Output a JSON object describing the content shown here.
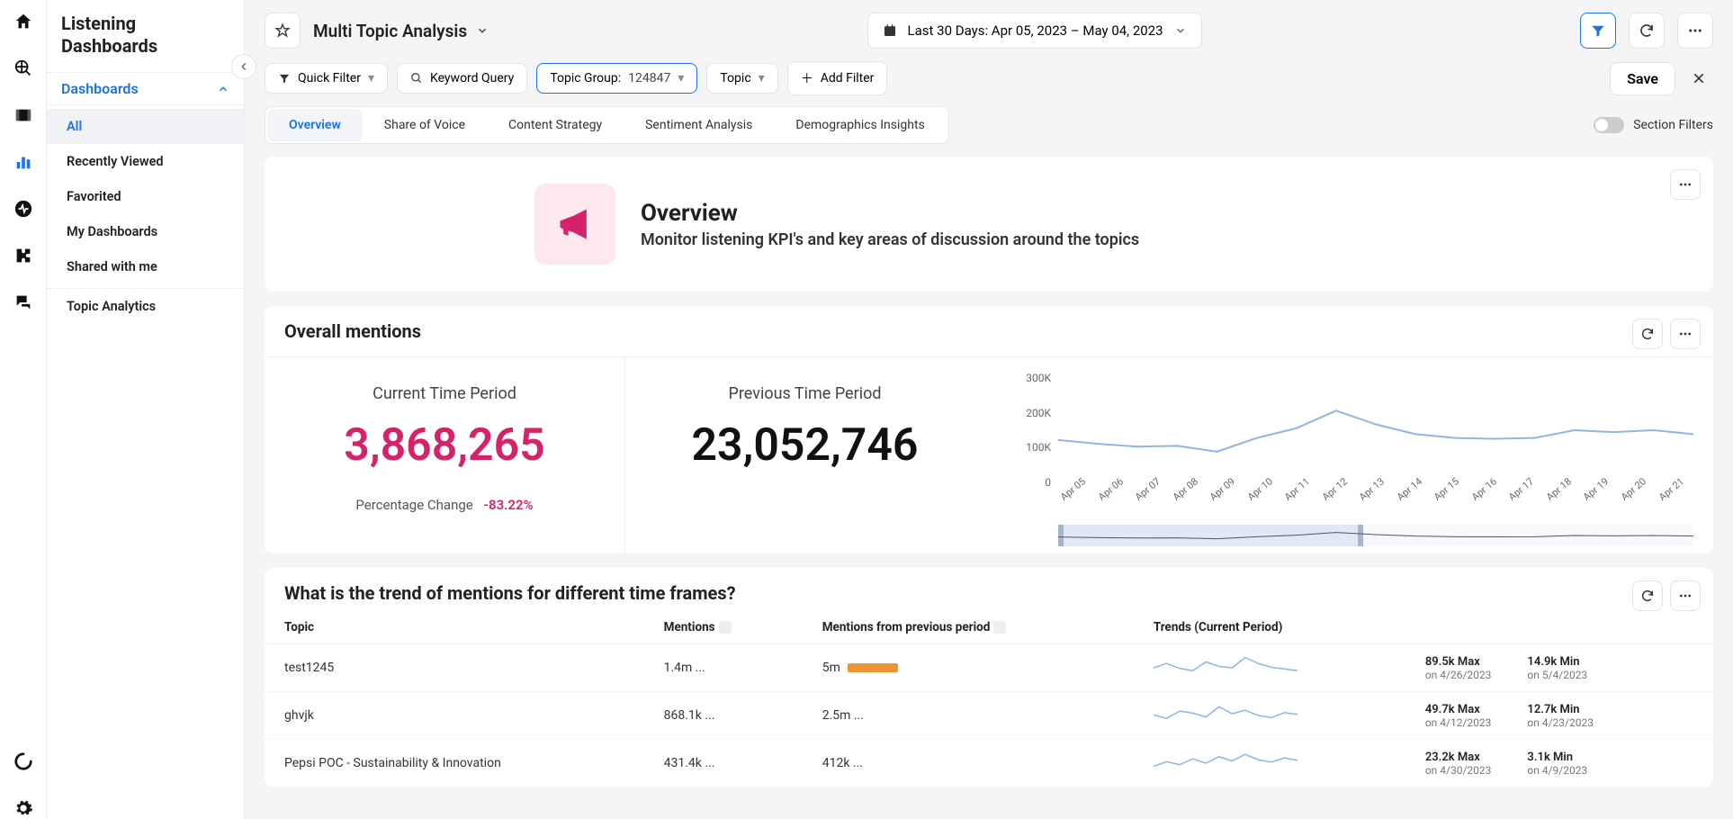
{
  "app_title": "Listening Dashboards",
  "sidebar": {
    "section_label": "Dashboards",
    "items": [
      "All",
      "Recently Viewed",
      "Favorited",
      "My Dashboards",
      "Shared with me"
    ],
    "secondary": "Topic Analytics"
  },
  "topbar": {
    "title": "Multi Topic Analysis",
    "date_label": "Last 30 Days: Apr 05, 2023 – May 04, 2023"
  },
  "filters": {
    "quick_filter": "Quick Filter",
    "keyword_query": "Keyword Query",
    "topic_group_label": "Topic Group:",
    "topic_group_value": "124847",
    "topic": "Topic",
    "add_filter": "Add Filter",
    "save": "Save"
  },
  "tabs": [
    "Overview",
    "Share of Voice",
    "Content Strategy",
    "Sentiment Analysis",
    "Demographics Insights"
  ],
  "section_filters_label": "Section Filters",
  "overview": {
    "title": "Overview",
    "subtitle": "Monitor listening KPI's and key areas of discussion around the topics"
  },
  "mentions": {
    "title": "Overall mentions",
    "current_label": "Current Time Period",
    "current_value": "3,868,265",
    "previous_label": "Previous Time Period",
    "previous_value": "23,052,746",
    "pct_label": "Percentage Change",
    "pct_value": "-83.22%"
  },
  "chart_data": {
    "type": "line",
    "title": "Overall mentions",
    "xlabel": "",
    "ylabel": "",
    "ylim": [
      0,
      300000
    ],
    "y_ticks": [
      "300K",
      "200K",
      "100K",
      "0"
    ],
    "x": [
      "Apr 05",
      "Apr 06",
      "Apr 07",
      "Apr 08",
      "Apr 09",
      "Apr 10",
      "Apr 11",
      "Apr 12",
      "Apr 13",
      "Apr 14",
      "Apr 15",
      "Apr 16",
      "Apr 17",
      "Apr 18",
      "Apr 19",
      "Apr 20",
      "Apr 21"
    ],
    "values": [
      125000,
      115000,
      108000,
      110000,
      95000,
      130000,
      155000,
      200000,
      165000,
      140000,
      130000,
      128000,
      130000,
      150000,
      145000,
      150000,
      140000
    ]
  },
  "trend": {
    "title": "What is the trend of mentions for different time frames?",
    "columns": [
      "Topic",
      "Mentions",
      "Mentions from previous period",
      "Trends (Current Period)"
    ],
    "rows": [
      {
        "topic": "test1245",
        "mentions": "1.4m ...",
        "prev": "5m",
        "bar_pct": 28,
        "max": "89.5k Max",
        "max_date": "on 4/26/2023",
        "min": "14.9k Min",
        "min_date": "on 5/4/2023",
        "spark": [
          40,
          55,
          38,
          30,
          60,
          45,
          40,
          75,
          55,
          42,
          36,
          30
        ]
      },
      {
        "topic": "ghvjk",
        "mentions": "868.1k ...",
        "prev": "2.5m ...",
        "bar_pct": 0,
        "max": "49.7k Max",
        "max_date": "on 4/12/2023",
        "min": "12.7k Min",
        "min_date": "on 4/23/2023",
        "spark": [
          42,
          30,
          55,
          48,
          35,
          70,
          46,
          58,
          40,
          33,
          50,
          44
        ]
      },
      {
        "topic": "Pepsi POC - Sustainability & Innovation",
        "mentions": "431.4k ...",
        "prev": "412k ...",
        "bar_pct": 0,
        "max": "23.2k Max",
        "max_date": "on 4/30/2023",
        "min": "3.1k Min",
        "min_date": "on 4/9/2023",
        "spark": [
          30,
          45,
          35,
          55,
          40,
          62,
          48,
          70,
          52,
          44,
          58,
          50
        ]
      }
    ]
  }
}
